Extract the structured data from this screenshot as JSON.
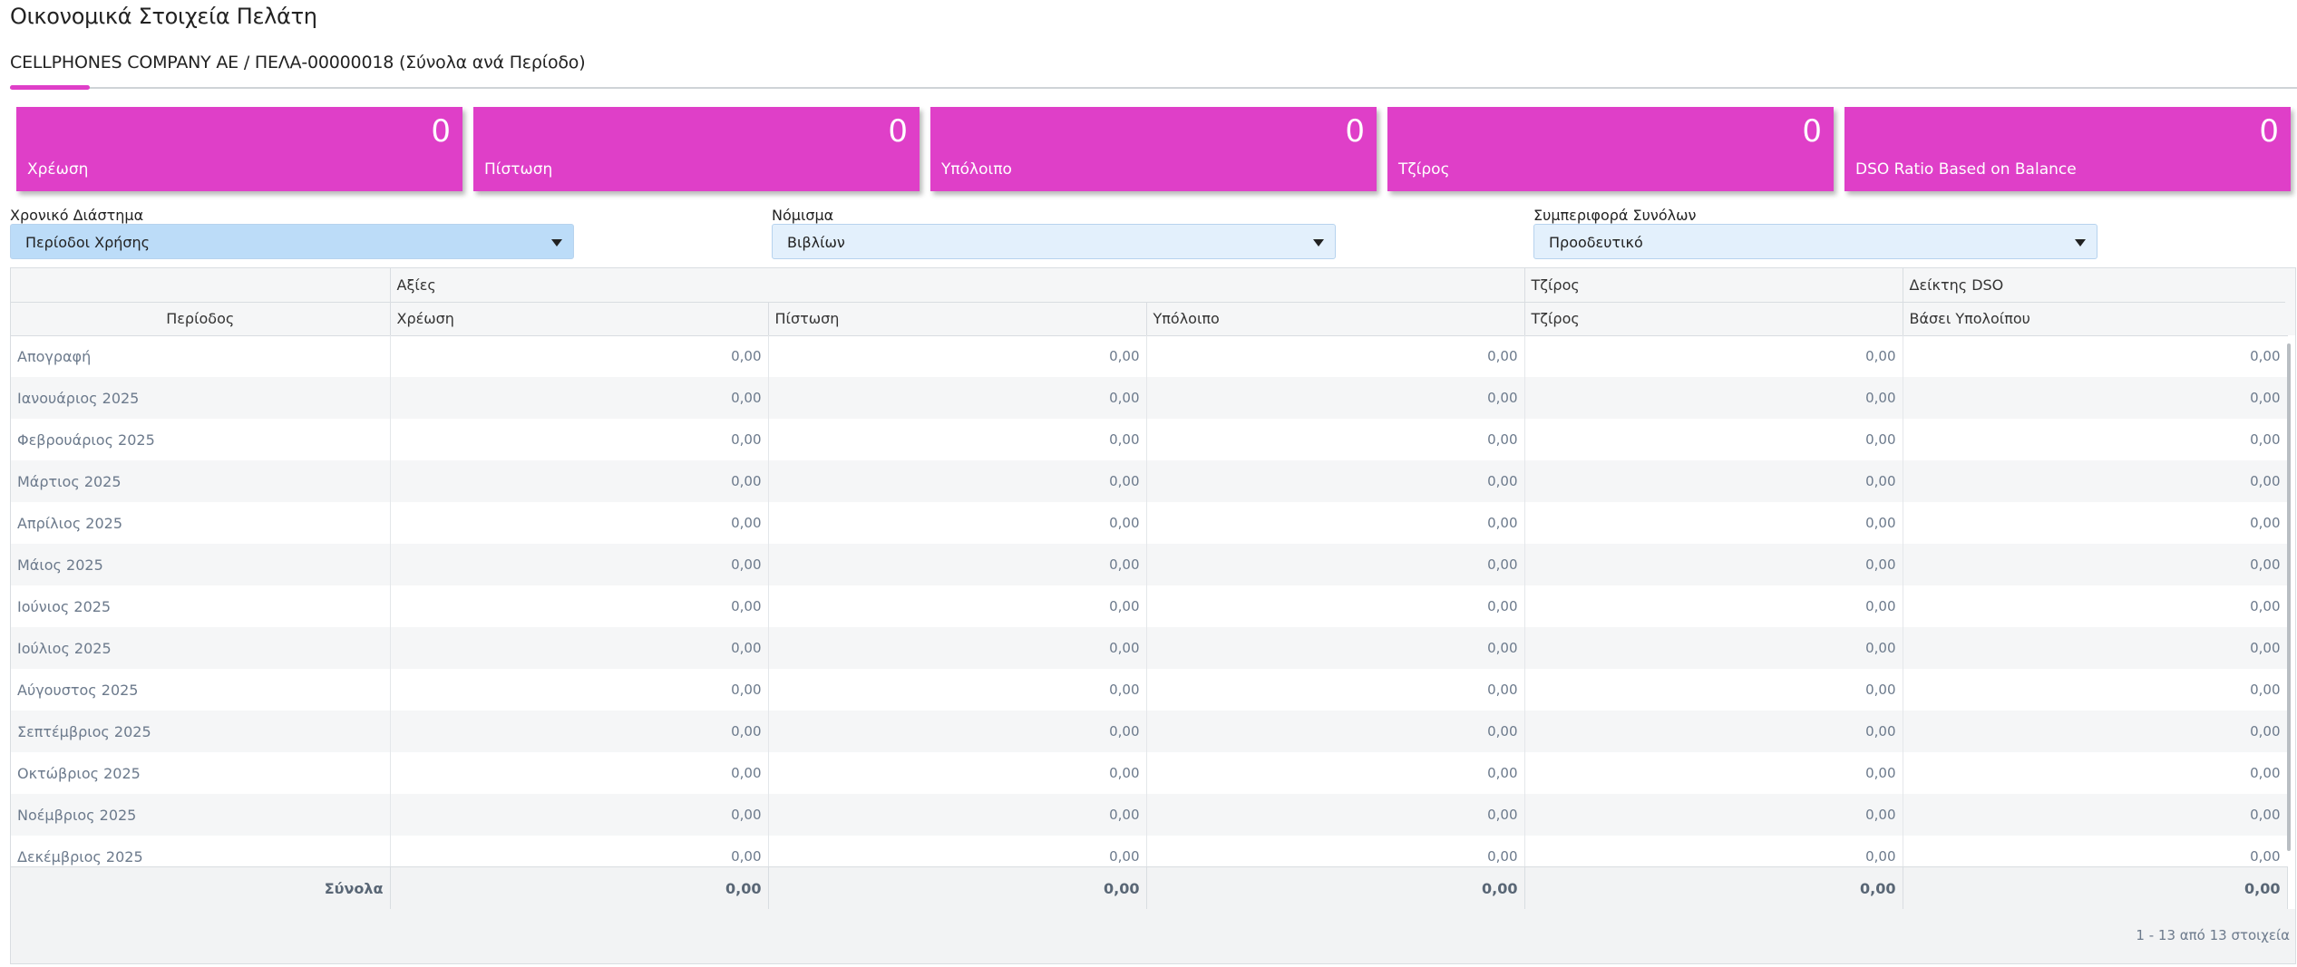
{
  "page": {
    "title": "Οικονομικά Στοιχεία Πελάτη",
    "subtitle": "CELLPHONES COMPANY AE / ΠΕΛΑ-00000018 (Σύνολα ανά Περίοδο)"
  },
  "colors": {
    "accent": "#df3fc8",
    "select_bg": "#e3f0fc",
    "select_active_bg": "#bcdcf8"
  },
  "kpis": [
    {
      "label": "Χρέωση",
      "value": "0"
    },
    {
      "label": "Πίστωση",
      "value": "0"
    },
    {
      "label": "Υπόλοιπο",
      "value": "0"
    },
    {
      "label": "Τζίρος",
      "value": "0"
    },
    {
      "label": "DSO Ratio Based on Balance",
      "value": "0"
    }
  ],
  "filters": [
    {
      "label": "Χρονικό Διάστημα",
      "value": "Περίοδοι Χρήσης"
    },
    {
      "label": "Νόμισμα",
      "value": "Βιβλίων"
    },
    {
      "label": "Συμπεριφορά Συνόλων",
      "value": "Προοδευτικό"
    }
  ],
  "grid": {
    "group_headers": {
      "values": "Αξίες",
      "turnover": "Τζίρος",
      "dso": "Δείκτης DSO"
    },
    "columns": {
      "period": "Περίοδος",
      "debit": "Χρέωση",
      "credit": "Πίστωση",
      "balance": "Υπόλοιπο",
      "turnover": "Τζίρος",
      "dso": "Βάσει Υπολοίπου"
    },
    "rows": [
      {
        "period": "Απογραφή",
        "debit": "0,00",
        "credit": "0,00",
        "balance": "0,00",
        "turnover": "0,00",
        "dso": "0,00"
      },
      {
        "period": "Ιανουάριος 2025",
        "debit": "0,00",
        "credit": "0,00",
        "balance": "0,00",
        "turnover": "0,00",
        "dso": "0,00"
      },
      {
        "period": "Φεβρουάριος 2025",
        "debit": "0,00",
        "credit": "0,00",
        "balance": "0,00",
        "turnover": "0,00",
        "dso": "0,00"
      },
      {
        "period": "Μάρτιος 2025",
        "debit": "0,00",
        "credit": "0,00",
        "balance": "0,00",
        "turnover": "0,00",
        "dso": "0,00"
      },
      {
        "period": "Απρίλιος 2025",
        "debit": "0,00",
        "credit": "0,00",
        "balance": "0,00",
        "turnover": "0,00",
        "dso": "0,00"
      },
      {
        "period": "Μάιος 2025",
        "debit": "0,00",
        "credit": "0,00",
        "balance": "0,00",
        "turnover": "0,00",
        "dso": "0,00"
      },
      {
        "period": "Ιούνιος 2025",
        "debit": "0,00",
        "credit": "0,00",
        "balance": "0,00",
        "turnover": "0,00",
        "dso": "0,00"
      },
      {
        "period": "Ιούλιος 2025",
        "debit": "0,00",
        "credit": "0,00",
        "balance": "0,00",
        "turnover": "0,00",
        "dso": "0,00"
      },
      {
        "period": "Αύγουστος 2025",
        "debit": "0,00",
        "credit": "0,00",
        "balance": "0,00",
        "turnover": "0,00",
        "dso": "0,00"
      },
      {
        "period": "Σεπτέμβριος 2025",
        "debit": "0,00",
        "credit": "0,00",
        "balance": "0,00",
        "turnover": "0,00",
        "dso": "0,00"
      },
      {
        "period": "Οκτώβριος 2025",
        "debit": "0,00",
        "credit": "0,00",
        "balance": "0,00",
        "turnover": "0,00",
        "dso": "0,00"
      },
      {
        "period": "Νοέμβριος 2025",
        "debit": "0,00",
        "credit": "0,00",
        "balance": "0,00",
        "turnover": "0,00",
        "dso": "0,00"
      },
      {
        "period": "Δεκέμβριος 2025",
        "debit": "0,00",
        "credit": "0,00",
        "balance": "0,00",
        "turnover": "0,00",
        "dso": "0,00"
      }
    ],
    "totals": {
      "label": "Σύνολα",
      "debit": "0,00",
      "credit": "0,00",
      "balance": "0,00",
      "turnover": "0,00",
      "dso": "0,00"
    },
    "pager_info": "1 - 13 από 13 στοιχεία"
  }
}
